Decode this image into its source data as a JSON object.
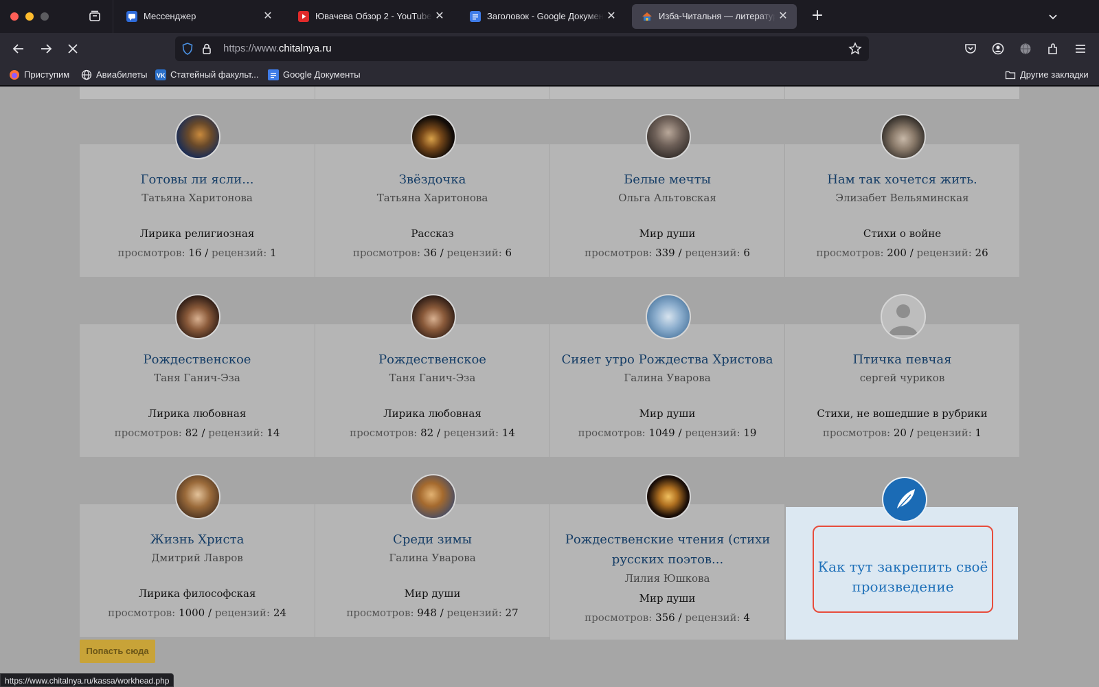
{
  "browser": {
    "tabs": [
      {
        "title": "Мессенджер",
        "favicon": "messenger-icon",
        "active": false
      },
      {
        "title": "Ювачева Обзор 2 - YouTube",
        "favicon": "youtube-icon",
        "active": false
      },
      {
        "title": "Заголовок - Google Документы",
        "favicon": "google-docs-icon",
        "active": false
      },
      {
        "title": "Изба-Читальня — литературный",
        "favicon": "chitalnya-icon",
        "active": true
      }
    ],
    "url": {
      "prefix": "https://www.",
      "domain": "chitalnya.ru"
    },
    "bookmarks": [
      {
        "label": "Приступим",
        "icon": "firefox-icon"
      },
      {
        "label": "Авиабилеты",
        "icon": "globe-icon"
      },
      {
        "label": "Статейный факульт...",
        "icon": "vk-icon"
      },
      {
        "label": "Google Документы",
        "icon": "google-docs-icon"
      }
    ],
    "other_bookmarks": "Другие закладки",
    "status_url": "https://www.chitalnya.ru/kassa/workhead.php"
  },
  "colors": {
    "link": "#153d66",
    "promo_link": "#1d6fb8",
    "promo_border": "#e74c3c",
    "button": "#c8a338"
  },
  "works": [
    {
      "title": "Готовы ли ясли...",
      "author": "Татьяна Харитонова",
      "genre": "Лирика религиозная",
      "views": "16",
      "reviews": "1"
    },
    {
      "title": "Звёздочка",
      "author": "Татьяна Харитонова",
      "genre": "Рассказ",
      "views": "36",
      "reviews": "6"
    },
    {
      "title": "Белые мечты",
      "author": "Ольга Альтовская",
      "genre": "Мир души",
      "views": "339",
      "reviews": "6"
    },
    {
      "title": "Нам так хочется жить.",
      "author": "Элизабет Вельяминская",
      "genre": "Стихи о войне",
      "views": "200",
      "reviews": "26"
    },
    {
      "title": "Рождественское",
      "author": "Таня Ганич-Эза",
      "genre": "Лирика любовная",
      "views": "82",
      "reviews": "14"
    },
    {
      "title": "Рождественское",
      "author": "Таня Ганич-Эза",
      "genre": "Лирика любовная",
      "views": "82",
      "reviews": "14"
    },
    {
      "title": "Сияет утро Рождества Христова",
      "author": "Галина Уварова",
      "genre": "Мир души",
      "views": "1049",
      "reviews": "19"
    },
    {
      "title": "Птичка певчая",
      "author": "сергей чуриков",
      "genre": "Стихи, не вошедшие в рубрики",
      "views": "20",
      "reviews": "1"
    },
    {
      "title": "Жизнь Христа",
      "author": "Дмитрий Лавров",
      "genre": "Лирика философская",
      "views": "1000",
      "reviews": "24"
    },
    {
      "title": "Среди зимы",
      "author": "Галина Уварова",
      "genre": "Мир души",
      "views": "948",
      "reviews": "27"
    },
    {
      "title": "Рождественские чтения (стихи русских поэтов...",
      "author": "Лилия Юшкова",
      "genre": "Мир души",
      "views": "356",
      "reviews": "4"
    }
  ],
  "labels": {
    "views": "просмотров:",
    "reviews": "рецензий:",
    "sep": " / "
  },
  "promo": {
    "text": "Как тут закрепить своё произведение",
    "icon": "feather-icon"
  },
  "get_here_button": "Попасть сюда"
}
